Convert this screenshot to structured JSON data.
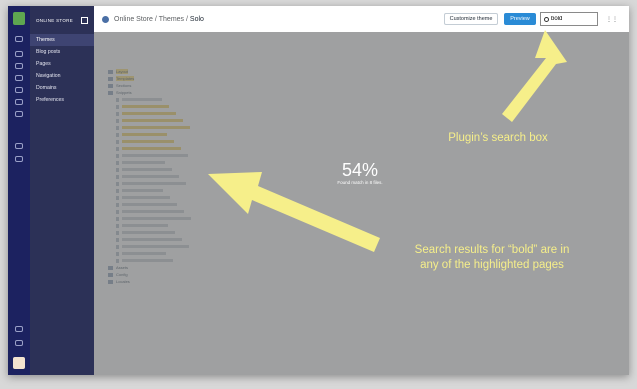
{
  "nav": {
    "header": "ONLINE STORE",
    "items": [
      {
        "label": "Themes",
        "active": true
      },
      {
        "label": "Blog posts"
      },
      {
        "label": "Pages"
      },
      {
        "label": "Navigation"
      },
      {
        "label": "Domains"
      },
      {
        "label": "Preferences"
      }
    ]
  },
  "header": {
    "breadcrumb_store": "Online Store",
    "breadcrumb_sep1": " / ",
    "breadcrumb_themes": "Themes",
    "breadcrumb_sep2": " / ",
    "breadcrumb_current": "Solo",
    "customize_label": "Customize theme",
    "preview_label": "Preview",
    "search_value": "bold"
  },
  "tree": {
    "folders": [
      "Layout",
      "Templates",
      "Sections",
      "Snippets"
    ],
    "bottom_folders": [
      "Assets",
      "Config",
      "Locales"
    ],
    "snippet_count": 24
  },
  "status": {
    "percent": "54%",
    "found_text": "Found match in 8 files."
  },
  "annotations": {
    "search_callout": "Plugin’s search box",
    "results_callout_line1": "Search results for “bold” are in",
    "results_callout_line2": "any of the highlighted pages"
  },
  "colors": {
    "nav_bg": "#2c3157",
    "rail_bg": "#1c2260",
    "preview_button": "#2a8bd6",
    "highlight": "#f1dd8e",
    "callout": "#f6ef8a"
  }
}
